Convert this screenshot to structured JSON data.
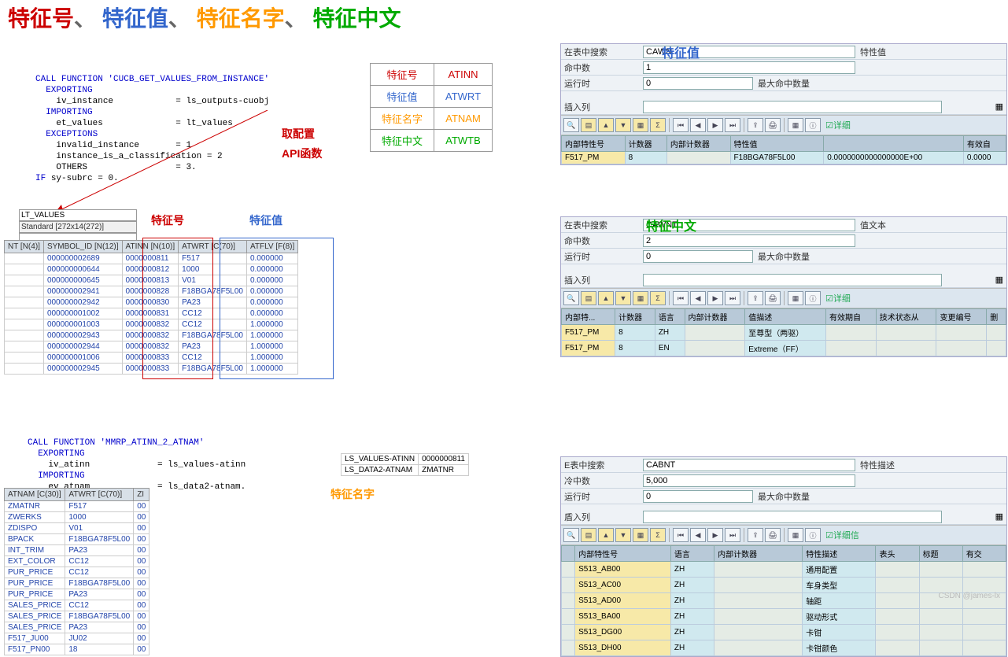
{
  "title": {
    "r": "特征号",
    "b": "特征值",
    "o": "特征名字",
    "g": "特征中文",
    "sep": "、"
  },
  "code1": {
    "l1a": "CALL FUNCTION ",
    "l1b": "'CUCB_GET_VALUES_FROM_INSTANCE'",
    "l2": "  EXPORTING",
    "l3a": "    iv_instance            = ",
    "l3b": "ls_outputs-cuobj",
    "l4": "  IMPORTING",
    "l5a": "    et_values              = ",
    "l5b": "lt_values",
    "l6": "  EXCEPTIONS",
    "l7a": "    invalid_instance       = ",
    "l7b": "1",
    "l8a": "    instance_is_a_classification = ",
    "l8b": "2",
    "l9a": "    OTHERS                 = ",
    "l9b": "3",
    "l10a": "IF ",
    "l10b": "sy-subrc ",
    "l10c": "= ",
    "l10d": "0."
  },
  "anno_code1a": "取配置",
  "anno_code1b": "API函数",
  "legend": [
    {
      "k": "特征号",
      "v": "ATINN",
      "cls": "r"
    },
    {
      "k": "特征值",
      "v": "ATWRT",
      "cls": "b"
    },
    {
      "k": "特征名字",
      "v": "ATNAM",
      "cls": "o"
    },
    {
      "k": "特征中文",
      "v": "ATWTB",
      "cls": "g"
    }
  ],
  "lt_values": {
    "input": "LT_VALUES",
    "std": "Standard [272x14(272)]",
    "blank": ""
  },
  "dt1": {
    "headers": [
      "NT [N(4)]",
      "SYMBOL_ID [N(12)]",
      "ATINN [N(10)]",
      "ATWRT [C(70)]",
      "ATFLV [F(8)]"
    ],
    "rows": [
      [
        "",
        "000000002689",
        "0000000811",
        "F517",
        "0.000000"
      ],
      [
        "",
        "000000000644",
        "0000000812",
        "1000",
        "0.000000"
      ],
      [
        "",
        "000000000645",
        "0000000813",
        "V01",
        "0.000000"
      ],
      [
        "",
        "000000002941",
        "0000000828",
        "F18BGA78F5L00",
        "0.000000"
      ],
      [
        "",
        "000000002942",
        "0000000830",
        "PA23",
        "0.000000"
      ],
      [
        "",
        "000000001002",
        "0000000831",
        "CC12",
        "0.000000"
      ],
      [
        "",
        "000000001003",
        "0000000832",
        "CC12",
        "1.000000"
      ],
      [
        "",
        "000000002943",
        "0000000832",
        "F18BGA78F5L00",
        "1.000000"
      ],
      [
        "",
        "000000002944",
        "0000000832",
        "PA23",
        "1.000000"
      ],
      [
        "",
        "000000001006",
        "0000000833",
        "CC12",
        "1.000000"
      ],
      [
        "",
        "000000002945",
        "0000000833",
        "F18BGA78F5L00",
        "1.000000"
      ]
    ]
  },
  "anno_ft_num": "特征号",
  "anno_ft_val": "特征值",
  "code2": {
    "l1a": "CALL FUNCTION ",
    "l1b": "'MMRP_ATINN_2_ATNAM'",
    "l2": "  EXPORTING",
    "l3a": "    iv_atinn             = ",
    "l3b": "ls_values-atinn",
    "l4": "  IMPORTING",
    "l5a": "    ev_atnam             = ",
    "l5b": "ls_data2-atnam"
  },
  "dt3": {
    "rows": [
      [
        "LS_VALUES-ATINN",
        "0000000811"
      ],
      [
        "LS_DATA2-ATNAM",
        "ZMATNR"
      ]
    ]
  },
  "anno_ft_name": "特征名字",
  "dt2": {
    "headers": [
      "ATNAM [C(30)]",
      "ATWRT [C(70)]",
      "ZI"
    ],
    "rows": [
      [
        "ZMATNR",
        "F517",
        "00"
      ],
      [
        "ZWERKS",
        "1000",
        "00"
      ],
      [
        "ZDISPO",
        "V01",
        "00"
      ],
      [
        "BPACK",
        "F18BGA78F5L00",
        "00"
      ],
      [
        "INT_TRIM",
        "PA23",
        "00"
      ],
      [
        "EXT_COLOR",
        "CC12",
        "00"
      ],
      [
        "PUR_PRICE",
        "CC12",
        "00"
      ],
      [
        "PUR_PRICE",
        "F18BGA78F5L00",
        "00"
      ],
      [
        "PUR_PRICE",
        "PA23",
        "00"
      ],
      [
        "SALES_PRICE",
        "CC12",
        "00"
      ],
      [
        "SALES_PRICE",
        "F18BGA78F5L00",
        "00"
      ],
      [
        "SALES_PRICE",
        "PA23",
        "00"
      ],
      [
        "F517_JU00",
        "JU02",
        "00"
      ],
      [
        "F517_PN00",
        "18",
        "00"
      ]
    ]
  },
  "sap1": {
    "anno": "特征值",
    "search_lbl": "在表中搜索",
    "search_val": "CAWN",
    "search_lbl2": "特性值",
    "hit_lbl": "命中数",
    "hit_val": "1",
    "run_lbl": "运行时",
    "run_val": "0",
    "run_lbl2": "最大命中数量",
    "ins_lbl": "插入列",
    "ins_val": "",
    "detail": "详细",
    "headers": [
      "内部特性号",
      "计数器",
      "内部计数器",
      "特性值",
      "",
      "有效自"
    ],
    "rows": [
      [
        "F517_PM",
        "8",
        "",
        "F18BGA78F5L00",
        "0.0000000000000000E+00",
        "0.0000"
      ]
    ]
  },
  "sap2": {
    "anno": "特征中文",
    "search_lbl": "在表中搜索",
    "search_val": "CAWNT",
    "search_lbl2": "值文本",
    "hit_lbl": "命中数",
    "hit_val": "2",
    "run_lbl": "运行时",
    "run_val": "0",
    "run_lbl2": "最大命中数量",
    "ins_lbl": "插入列",
    "ins_val": "",
    "detail": "详细",
    "headers": [
      "内部特...",
      "计数器",
      "语言",
      "内部计数器",
      "值描述",
      "有效期自",
      "技术状态从",
      "变更编号",
      "删"
    ],
    "rows": [
      [
        "F517_PM",
        "8",
        "ZH",
        "",
        "至尊型（两驱）",
        "",
        "",
        "",
        ""
      ],
      [
        "F517_PM",
        "8",
        "EN",
        "",
        "Extreme（FF）",
        "",
        "",
        "",
        ""
      ]
    ]
  },
  "sap3": {
    "search_lbl": "E表中搜索",
    "search_val": "CABNT",
    "search_lbl2": "特性描述",
    "hit_lbl": "冷中数",
    "hit_val": "5,000",
    "run_lbl": "运行时",
    "run_val": "0",
    "run_lbl2": "最大命中数量",
    "ins_lbl": "盾入列",
    "ins_val": "",
    "detail": "详细信",
    "headers": [
      "",
      "内部特性号",
      "语言",
      "内部计数器",
      "特性描述",
      "表头",
      "标题",
      "有交"
    ],
    "rows": [
      [
        "",
        "S513_AB00",
        "ZH",
        "",
        "通用配置",
        "",
        "",
        ""
      ],
      [
        "",
        "S513_AC00",
        "ZH",
        "",
        "车身类型",
        "",
        "",
        ""
      ],
      [
        "",
        "S513_AD00",
        "ZH",
        "",
        "轴距",
        "",
        "",
        ""
      ],
      [
        "",
        "S513_BA00",
        "ZH",
        "",
        "驱动形式",
        "",
        "",
        ""
      ],
      [
        "",
        "S513_DG00",
        "ZH",
        "",
        "卡钳",
        "",
        "",
        ""
      ],
      [
        "",
        "S513_DH00",
        "ZH",
        "",
        "卡钳颜色",
        "",
        "",
        ""
      ]
    ]
  },
  "watermark": "CSDN @james-lx"
}
